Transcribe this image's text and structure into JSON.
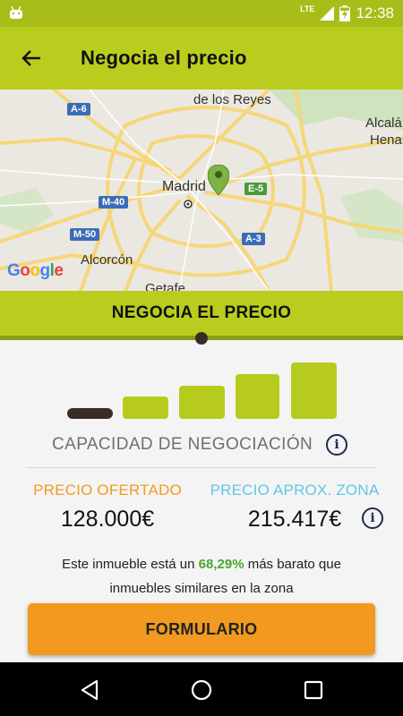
{
  "status_bar": {
    "network": "LTE",
    "time": "12:38"
  },
  "app_bar": {
    "title": "Negocia el precio"
  },
  "map": {
    "labels": {
      "reyes": "de los Reyes",
      "alcala": "Alcalá",
      "henares": "Henar",
      "madrid": "Madrid",
      "alcorcon": "Alcorcón",
      "getafe": "Getafe"
    },
    "road_signs": {
      "a6": "A-6",
      "m40": "M-40",
      "m50": "M-50",
      "e5": "E-5",
      "a3": "A-3"
    },
    "logo": "Google"
  },
  "banner": {
    "title": "NEGOCIA EL PRECIO"
  },
  "negotiation": {
    "level_bars": 5,
    "current_level": 1,
    "capacity_label": "CAPACIDAD DE NEGOCIACIÓN"
  },
  "prices": {
    "offered_label": "PRECIO OFERTADO",
    "offered_value": "128.000€",
    "zone_label": "PRECIO APROX. ZONA",
    "zone_value": "215.417€"
  },
  "comparison": {
    "before": "Este inmueble está un ",
    "percent": "68,29%",
    "after_line1": " más barato que",
    "line2": "inmuebles similares en la zona"
  },
  "cta": {
    "label": "FORMULARIO"
  },
  "colors": {
    "brand": "#bacd1f",
    "accent_orange": "#f29a1f",
    "accent_blue": "#5fc7e5",
    "dark": "#3a2b25"
  }
}
